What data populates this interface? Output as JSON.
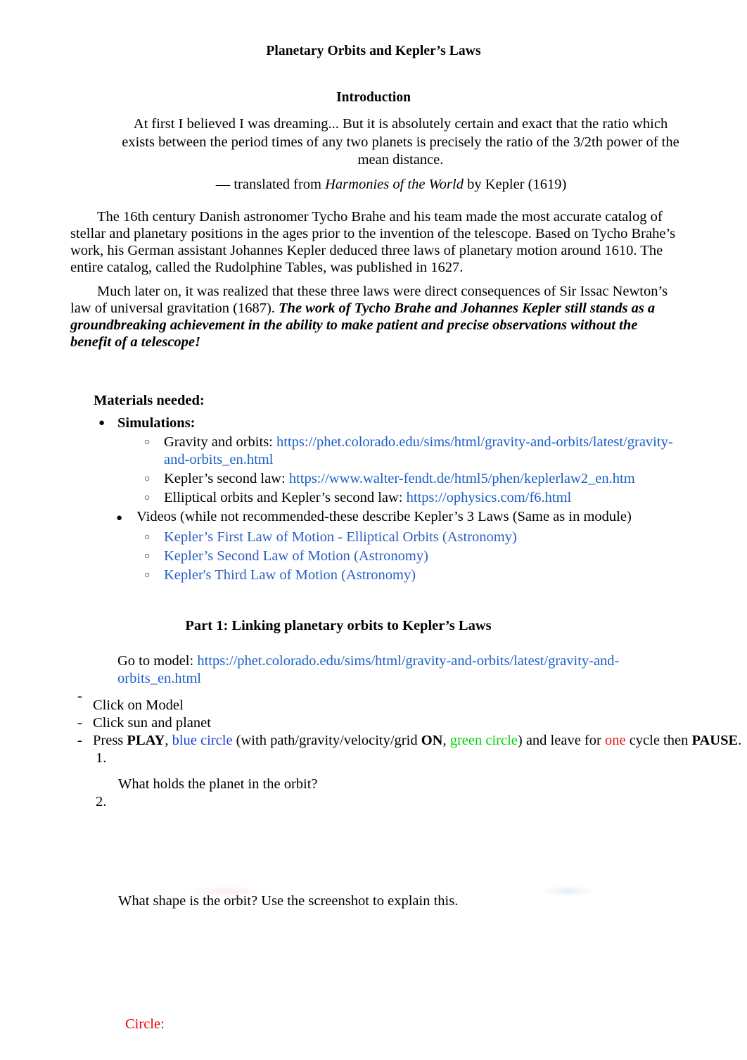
{
  "document": {
    "title": "Planetary Orbits and Kepler’s Laws",
    "intro_heading": "Introduction",
    "quote": "At first I believed I was dreaming... But it is absolutely certain and exact that the ratio which exists between the period times of any two planets is precisely the ratio of the 3/2th power of the mean distance.",
    "quote_attribution_pre": "— translated from ",
    "quote_attribution_italic": "Harmonies of the World",
    "quote_attribution_post": " by Kepler (1619)",
    "paragraph_1": "The 16th century Danish astronomer Tycho Brahe and his team made the most accurate catalog of stellar and planetary positions in the ages prior to the invention of the telescope. Based on Tycho Brahe’s work, his German assistant Johannes Kepler deduced three laws of planetary motion around 1610. The entire catalog, called the Rudolphine Tables, was published in 1627.",
    "paragraph_2_plain": "Much later on, it was realized that these three laws were direct consequences of Sir Issac Newton’s law of universal gravitation (1687). ",
    "paragraph_2_bold_italic": "The work of Tycho Brahe and Johannes Kepler still stands as a groundbreaking achievement in the ability to make patient and precise observations without the benefit of a telescope!"
  },
  "materials": {
    "heading": "Materials needed:",
    "bullet_filled": "●",
    "bullet_hollow": "○",
    "simulations_label": "Simulations:",
    "simulations": [
      {
        "label": "Gravity and orbits: ",
        "link": "https://phet.colorado.edu/sims/html/gravity-and-orbits/latest/gravity-and-orbits_en.html"
      },
      {
        "label": "Kepler’s second law: ",
        "link": "https://www.walter-fendt.de/html5/phen/keplerlaw2_en.htm"
      },
      {
        "label": "Elliptical orbits and Kepler’s second law:  ",
        "link": "https://ophysics.com/f6.html"
      }
    ],
    "videos_label": "Videos (while not recommended-these describe Kepler’s 3 Laws (Same as in module)",
    "videos": [
      "Kepler’s First Law of Motion - Elliptical Orbits  (Astronomy)",
      "Kepler’s Second Law of Motion  (Astronomy)",
      "Kepler's Third Law of Motion  (Astronomy)"
    ]
  },
  "part1": {
    "heading": "Part 1: Linking planetary orbits to Kepler’s Laws",
    "goto_label": "Go to model: ",
    "goto_link": "https://phet.colorado.edu/sims/html/gravity-and-orbits/latest/gravity-and-orbits_en.html",
    "dash": "-",
    "steps": [
      {
        "text": "Click on Model"
      },
      {
        "text": "Click sun and planet"
      }
    ],
    "press_step": {
      "t1": "Press ",
      "play": "PLAY",
      "t2": ", ",
      "blue_circle": "blue circle",
      "t3": " (with path/gravity/velocity/grid ",
      "on": "ON",
      "t4": ", ",
      "green_circle": "green circle",
      "t5": ") and leave for ",
      "one": "one",
      "t6": " cycle then ",
      "pause": "PAUSE",
      "t7": "."
    },
    "questions": [
      {
        "number": "1.",
        "text": "What holds the planet in the orbit?"
      },
      {
        "number": "2.",
        "text": "What shape is the orbit?  Use the screenshot to explain this."
      }
    ],
    "circle_note": "Circle:"
  },
  "colors": {
    "link_blue": "#1a5fc8",
    "video_link_blue": "#2c5fc4",
    "accent_blue": "#1a3fe0",
    "accent_green": "#00d400",
    "accent_red": "#ee1111",
    "note_red": "#ee0000"
  }
}
